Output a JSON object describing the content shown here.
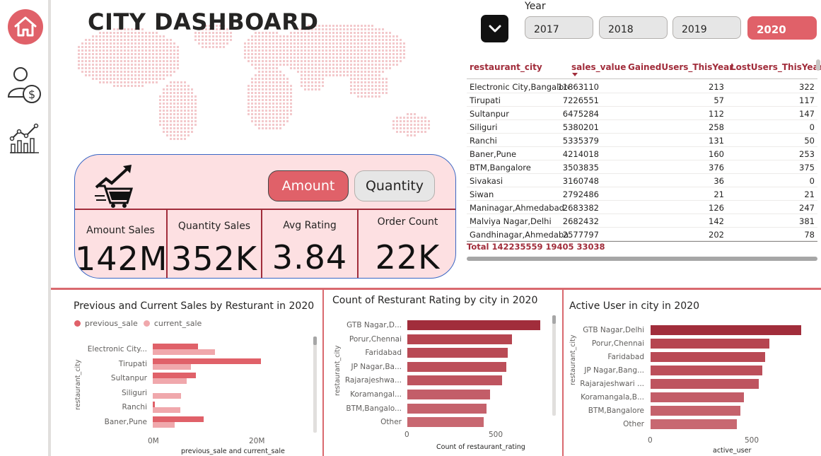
{
  "header": {
    "title": "CITY DASHBOARD"
  },
  "nav": {
    "items": [
      "home-icon",
      "users-money-icon",
      "analytics-icon"
    ],
    "accent": "#e06169"
  },
  "year_slicer": {
    "label": "Year",
    "options": [
      "2017",
      "2018",
      "2019",
      "2020"
    ],
    "selected": "2020"
  },
  "table": {
    "columns": [
      "restaurant_city",
      "sales_value",
      "GainedUsers_ThisYear",
      "LostUsers_ThisYear"
    ],
    "rows": [
      [
        "Electronic City,Bangalore",
        "11863110",
        "213",
        "322"
      ],
      [
        "Tirupati",
        "7226551",
        "57",
        "117"
      ],
      [
        "Sultanpur",
        "6475284",
        "112",
        "147"
      ],
      [
        "Siliguri",
        "5380201",
        "258",
        "0"
      ],
      [
        "Ranchi",
        "5335379",
        "131",
        "50"
      ],
      [
        "Baner,Pune",
        "4214018",
        "160",
        "253"
      ],
      [
        "BTM,Bangalore",
        "3503835",
        "376",
        "375"
      ],
      [
        "Sivakasi",
        "3160748",
        "36",
        "0"
      ],
      [
        "Siwan",
        "2792486",
        "21",
        "21"
      ],
      [
        "Maninagar,Ahmedabad",
        "2683382",
        "126",
        "247"
      ],
      [
        "Malviya Nagar,Delhi",
        "2682432",
        "142",
        "381"
      ],
      [
        "Gandhinagar,Ahmedaba",
        "2577797",
        "202",
        "78"
      ]
    ],
    "total": [
      "Total",
      "142235559",
      "19405",
      "33038"
    ]
  },
  "kpi": {
    "toggle": {
      "amount": "Amount",
      "quantity": "Quantity",
      "selected": "Amount"
    },
    "cards": [
      {
        "label": "Amount Sales",
        "value": "142M"
      },
      {
        "label": "Quantity Sales",
        "value": "352K"
      },
      {
        "label": "Avg Rating",
        "value": "3.84"
      },
      {
        "label": "Order Count",
        "value": "22K"
      }
    ]
  },
  "charts": {
    "sales": {
      "title": "Previous and Current Sales by Resturant in 2020",
      "legend": [
        "previous_sale",
        "current_sale"
      ],
      "ylabel": "restaurant_city",
      "xlabel": "previous_sale and current_sale",
      "ticks": [
        "0M",
        "20M"
      ]
    },
    "rating": {
      "title": "Count of Resturant Rating by city in 2020",
      "ylabel": "restaurant_city",
      "xlabel": "Count of restaurant_rating",
      "ticks": [
        "0",
        "500"
      ]
    },
    "active": {
      "title": "Active User in city in 2020",
      "ylabel": "restaurant_city",
      "xlabel": "active_user",
      "ticks": [
        "0",
        "500"
      ]
    }
  },
  "chart_data": [
    {
      "type": "bar",
      "title": "Previous and Current Sales by Resturant in 2020",
      "categories": [
        "Electronic City...",
        "Tirupati",
        "Sultanpur",
        "Siliguri",
        "Ranchi",
        "Baner,Pune"
      ],
      "series": [
        {
          "name": "previous_sale",
          "values": [
            8600000,
            20500000,
            8200000,
            0,
            400000,
            9700000
          ],
          "color": "#e06169"
        },
        {
          "name": "current_sale",
          "values": [
            11800000,
            7200000,
            6500000,
            5400000,
            5300000,
            4200000
          ],
          "color": "#f0a8ac"
        }
      ],
      "xlabel": "previous_sale and current_sale",
      "ylabel": "restaurant_city",
      "xlim": [
        0,
        31000000
      ]
    },
    {
      "type": "bar",
      "title": "Count of Resturant Rating by city in 2020",
      "categories": [
        "GTB Nagar,D...",
        "Porur,Chennai",
        "Faridabad",
        "JP Nagar,Ba...",
        "Rajarajeshwa...",
        "Koramangal...",
        "BTM,Bangalo...",
        "Other"
      ],
      "values": [
        630,
        495,
        475,
        470,
        450,
        390,
        375,
        360
      ],
      "xlabel": "Count of restaurant_rating",
      "ylabel": "restaurant_city",
      "xlim": [
        0,
        800
      ]
    },
    {
      "type": "bar",
      "title": "Active User in city in 2020",
      "categories": [
        "GTB Nagar,Delhi",
        "Porur,Chennai",
        "Faridabad",
        "JP Nagar,Bang...",
        "Rajarajeshwari ...",
        "Koramangala,B...",
        "BTM,Bangalore",
        "Other"
      ],
      "values": [
        620,
        490,
        470,
        460,
        445,
        385,
        370,
        355
      ],
      "xlabel": "active_user",
      "ylabel": "restaurant_city",
      "xlim": [
        0,
        800
      ]
    }
  ]
}
